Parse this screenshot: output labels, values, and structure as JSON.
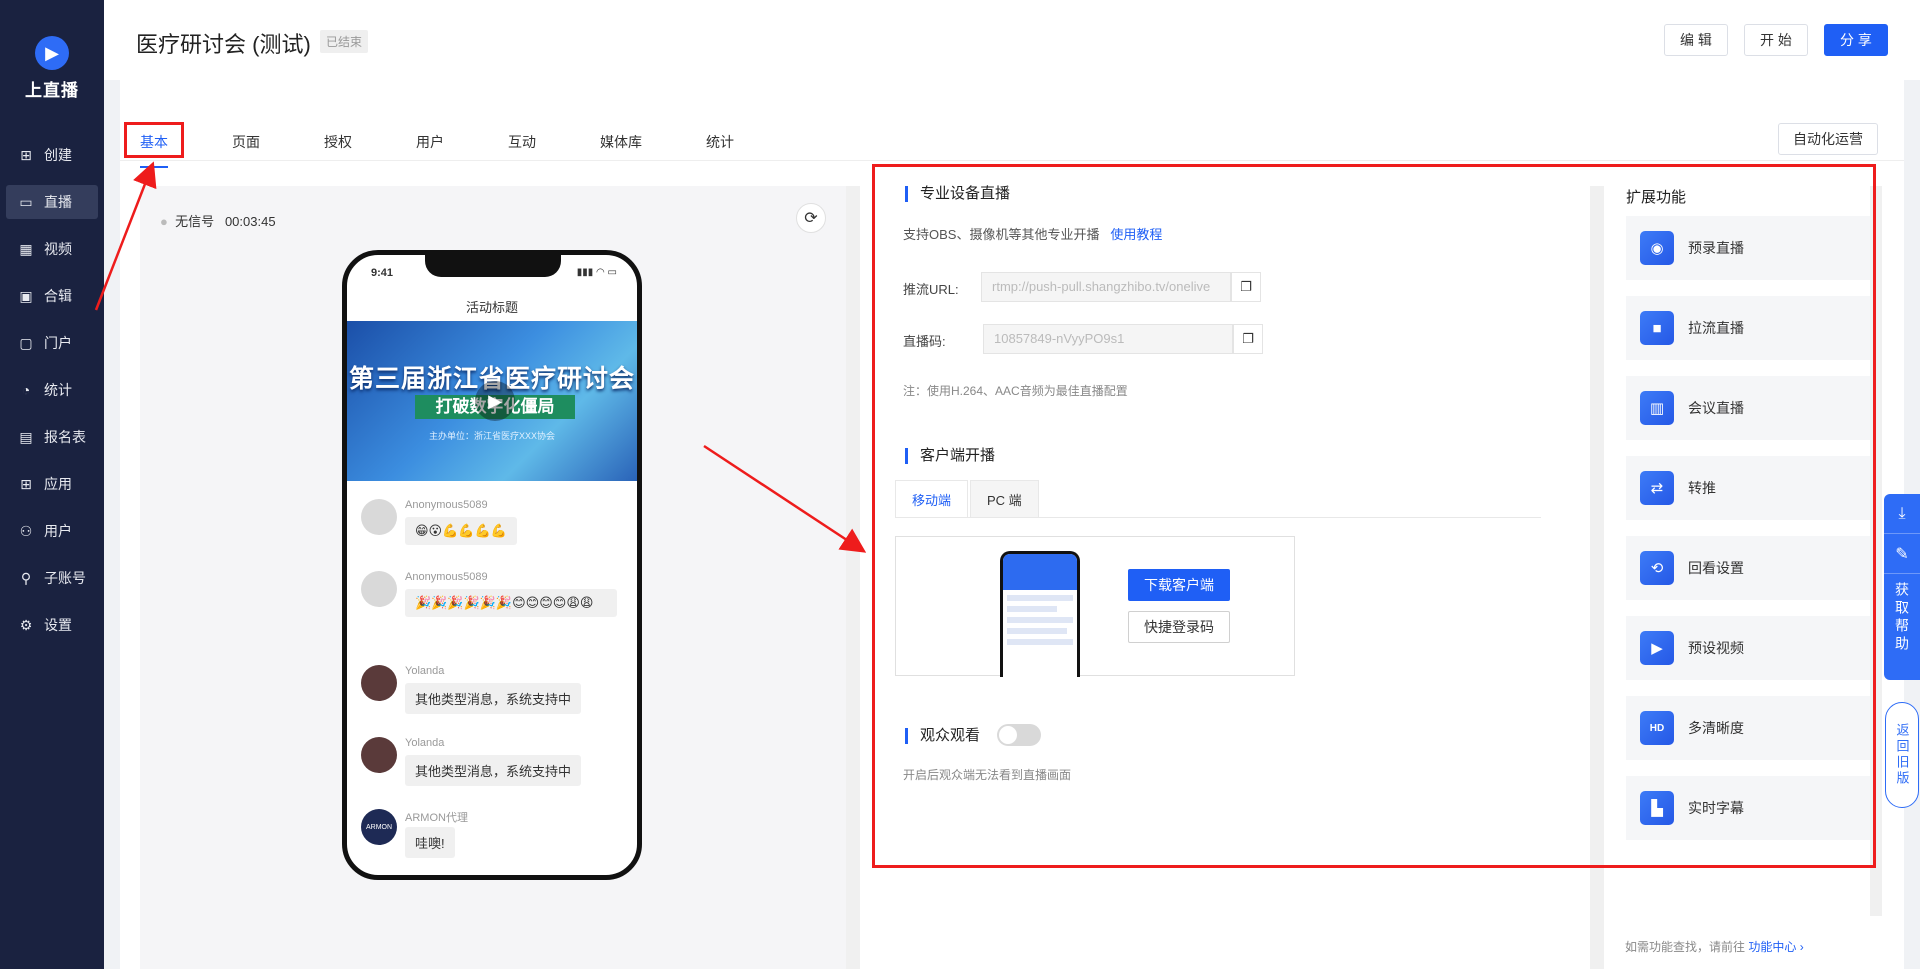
{
  "app": {
    "logo_text": "上直播"
  },
  "sidebar": {
    "items": [
      {
        "label": "创建",
        "icon": "plus-square-icon"
      },
      {
        "label": "直播",
        "icon": "video-icon",
        "active": true
      },
      {
        "label": "视频",
        "icon": "film-icon"
      },
      {
        "label": "合辑",
        "icon": "collection-icon"
      },
      {
        "label": "门户",
        "icon": "monitor-icon"
      },
      {
        "label": "统计",
        "icon": "pie-chart-icon"
      },
      {
        "label": "报名表",
        "icon": "form-icon"
      },
      {
        "label": "应用",
        "icon": "apps-icon"
      },
      {
        "label": "用户",
        "icon": "users-icon"
      },
      {
        "label": "子账号",
        "icon": "sub-account-icon"
      },
      {
        "label": "设置",
        "icon": "gear-icon"
      }
    ]
  },
  "header": {
    "title": "医疗研讨会 (测试)",
    "status_badge": "已结束",
    "edit_label": "编 辑",
    "start_label": "开 始",
    "share_label": "分 享"
  },
  "tabs": [
    "基本",
    "页面",
    "授权",
    "用户",
    "互动",
    "媒体库",
    "统计"
  ],
  "auto_ops_label": "自动化运营",
  "preview": {
    "signal_status": "无信号",
    "duration": "00:03:45",
    "phone": {
      "time": "9:41",
      "title": "活动标题",
      "banner_title": "第三届浙江省医疗研讨会",
      "banner_subtitle": "打破数字化僵局",
      "banner_host": "主办单位：浙江省医疗XXX协会"
    },
    "messages": [
      {
        "name": "Anonymous5089",
        "text": "😁😮💪💪💪💪",
        "avatar": "default"
      },
      {
        "name": "Anonymous5089",
        "text": "🎉🎉🎉🎉🎉🎉😊😊😊😊😩😩",
        "avatar": "default"
      },
      {
        "name": "Yolanda",
        "text": "其他类型消息，系统支持中",
        "avatar": "photo"
      },
      {
        "name": "Yolanda",
        "text": "其他类型消息，系统支持中",
        "avatar": "photo"
      },
      {
        "name": "ARMON代理",
        "text": "哇噢!",
        "avatar": "logo"
      }
    ]
  },
  "pro_stream": {
    "title": "专业设备直播",
    "desc": "支持OBS、摄像机等其他专业开播",
    "tutorial_link": "使用教程",
    "push_url_label": "推流URL:",
    "push_url_value": "rtmp://push-pull.shangzhibo.tv/onelive",
    "stream_code_label": "直播码:",
    "stream_code_value": "10857849-nVyyPO9s1",
    "note": "注：使用H.264、AAC音频为最佳直播配置"
  },
  "client_stream": {
    "title": "客户端开播",
    "tab_mobile": "移动端",
    "tab_pc": "PC 端",
    "download_label": "下载客户端",
    "quick_login_label": "快捷登录码"
  },
  "audience": {
    "title": "观众观看",
    "note": "开启后观众端无法看到直播画面",
    "enabled": false
  },
  "extensions": {
    "title": "扩展功能",
    "items": [
      {
        "label": "预录直播",
        "icon": "record-icon"
      },
      {
        "label": "拉流直播",
        "icon": "camera-icon"
      },
      {
        "label": "会议直播",
        "icon": "meeting-icon"
      },
      {
        "label": "转推",
        "icon": "repush-icon"
      },
      {
        "label": "回看设置",
        "icon": "playback-icon"
      },
      {
        "label": "预设视频",
        "icon": "preset-video-icon"
      },
      {
        "label": "多清晰度",
        "icon": "hd-icon"
      },
      {
        "label": "实时字幕",
        "icon": "subtitle-icon"
      }
    ],
    "footer_text": "如需功能查找，请前往",
    "footer_link": "功能中心 ›"
  },
  "floating": {
    "help_label": "获取帮助",
    "old_version_label": "返回旧版"
  },
  "colors": {
    "sidebar_bg": "#1a2240",
    "accent": "#1f5ff5",
    "annotation_red": "#ee1c1c"
  }
}
